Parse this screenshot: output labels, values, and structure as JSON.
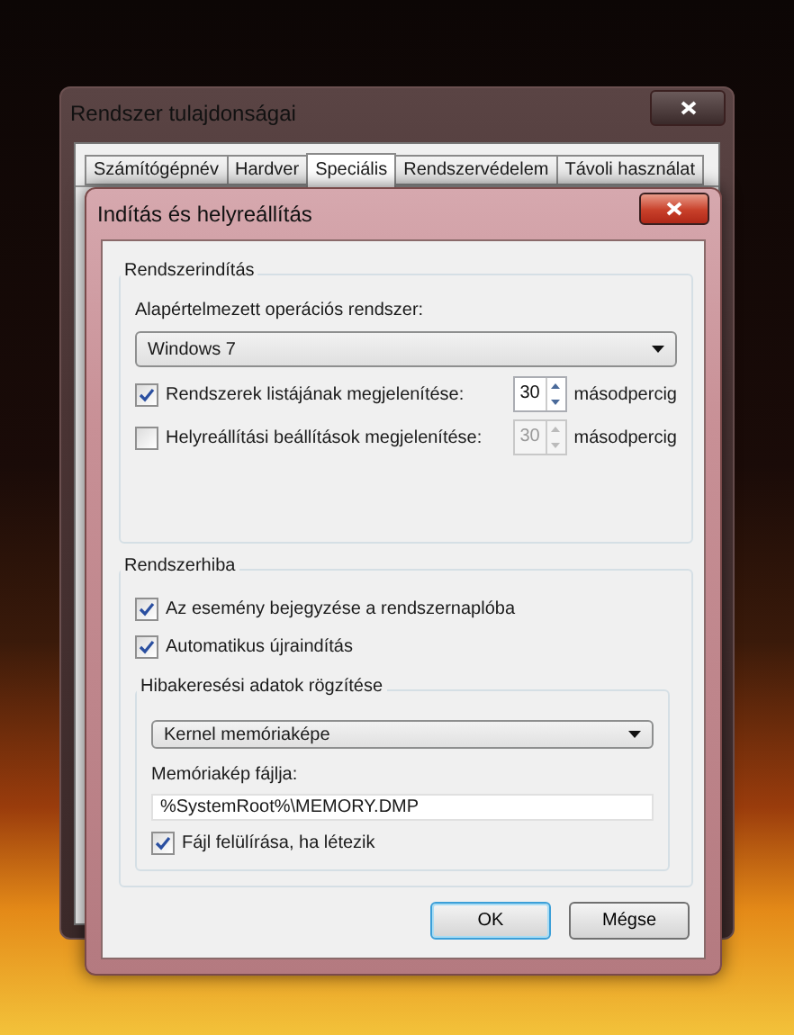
{
  "outer_window": {
    "title": "Rendszer tulajdonságai",
    "tabs": [
      {
        "label": "Számítógépnév",
        "selected": false
      },
      {
        "label": "Hardver",
        "selected": false
      },
      {
        "label": "Speciális",
        "selected": true
      },
      {
        "label": "Rendszervédelem",
        "selected": false
      },
      {
        "label": "Távoli használat",
        "selected": false
      }
    ]
  },
  "dialog": {
    "title": "Indítás és helyreállítás",
    "startup": {
      "heading": "Rendszerindítás",
      "os_label": "Alapértelmezett operációs rendszer:",
      "os_value": "Windows 7",
      "options": [
        {
          "label": "Rendszerek listájának megjelenítése:",
          "checked": true,
          "value": "30",
          "unit": "másodpercig"
        },
        {
          "label": "Helyreállítási beállítások megjelenítése:",
          "checked": false,
          "value": "30",
          "unit": "másodpercig"
        }
      ]
    },
    "failure": {
      "heading": "Rendszerhiba",
      "options": [
        {
          "label": "Az esemény bejegyzése a rendszernaplóba",
          "checked": true
        },
        {
          "label": "Automatikus újraindítás",
          "checked": true
        }
      ],
      "debug": {
        "heading": "Hibakeresési adatok rögzítése",
        "dump_type": "Kernel memóriaképe",
        "file_label": "Memóriakép fájlja:",
        "file_value": "%SystemRoot%\\MEMORY.DMP",
        "overwrite": {
          "label": "Fájl felülírása, ha létezik",
          "checked": true
        }
      }
    },
    "buttons": [
      {
        "label": "OK",
        "default": true
      },
      {
        "label": "Mégse",
        "default": false
      }
    ]
  }
}
